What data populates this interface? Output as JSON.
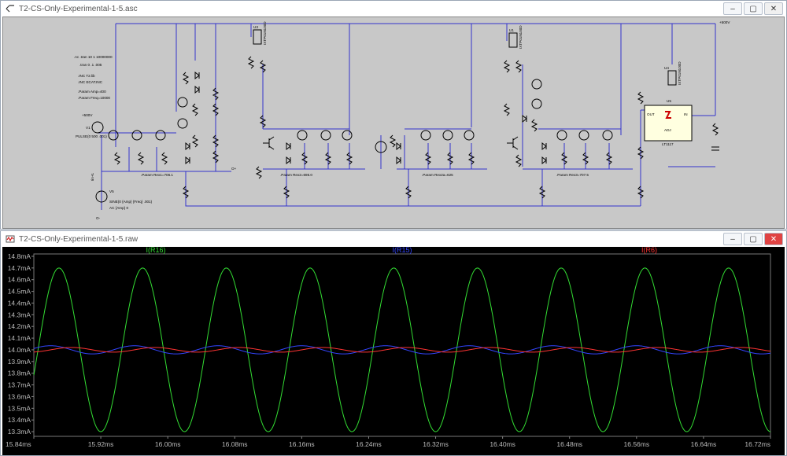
{
  "schematic_window": {
    "title": "T2-CS-Only-Experimental-1-5.asc",
    "colors": {
      "background": "#c8c8c8",
      "wire": "#3333cc",
      "component": "#000000"
    },
    "directives": [
      ".nc .tran 10 1 10000000",
      ".tran 0 .1 .005",
      ".INC T2.lib",
      ".INC ECAT.INC",
      ".Param Amp=400",
      ".Param Freq=10000"
    ],
    "supply_label": "+500V",
    "source_v1": "V1",
    "source_v1_value": "PULSE(0 500 .001)",
    "source_v5": "V5",
    "source_v5_value": "SINE(0 {Amp} {Freq} .001)",
    "source_v5_ac": "AC {Amp} 0",
    "probe_iin": "Iin+1",
    "params": [
      ".Param Rex1=706.1",
      ".Param Rex2=695.0",
      ".Param Rex2a=625",
      ".Param Rex3=707.5"
    ],
    "regulator": {
      "name": "U5",
      "part": "LT1117",
      "out": "OUT",
      "in": "IN",
      "adj": "ADJ"
    },
    "label_vo": "O+",
    "label_minus": "O-",
    "mosfets": [
      "U3",
      "U1",
      "U4"
    ],
    "mosfet_part": "IXTP01N100D"
  },
  "waveform_window": {
    "title": "T2-CS-Only-Experimental-1-5.raw",
    "x_ticks": [
      "15.84ms",
      "15.92ms",
      "16.00ms",
      "16.08ms",
      "16.16ms",
      "16.24ms",
      "16.32ms",
      "16.40ms",
      "16.48ms",
      "16.56ms",
      "16.64ms",
      "16.72ms"
    ],
    "y_ticks": [
      "14.8mA",
      "14.7mA",
      "14.6mA",
      "14.5mA",
      "14.4mA",
      "14.3mA",
      "14.2mA",
      "14.1mA",
      "14.0mA",
      "13.9mA",
      "13.8mA",
      "13.7mA",
      "13.6mA",
      "13.5mA",
      "13.4mA",
      "13.3mA"
    ],
    "traces": [
      {
        "name": "I(R16)",
        "color": "#33dd33"
      },
      {
        "name": "I(R15)",
        "color": "#3344ff"
      },
      {
        "name": "I(R6)",
        "color": "#ff3333"
      }
    ]
  },
  "window_buttons": {
    "minimize": "–",
    "maximize": "▢",
    "close": "✕"
  },
  "chart_data": {
    "type": "line",
    "xlabel": "",
    "ylabel": "",
    "x_unit": "ms",
    "y_unit": "mA",
    "xlim": [
      15.84,
      16.72
    ],
    "ylim": [
      13.26,
      14.82
    ],
    "grid": false,
    "legend": "top",
    "series": [
      {
        "name": "I(R16)",
        "color": "#33dd33",
        "kind": "sine",
        "offset": 14.0,
        "amplitude": 0.7,
        "period_ms": 0.1,
        "peak_ms": 15.87
      },
      {
        "name": "I(R15)",
        "color": "#3344ff",
        "kind": "sine",
        "offset": 14.0,
        "amplitude": 0.035,
        "period_ms": 0.1,
        "peak_ms": 15.86
      },
      {
        "name": "I(R6)",
        "color": "#ff3333",
        "kind": "sine",
        "offset": 14.0,
        "amplitude": 0.02,
        "period_ms": 0.1,
        "peak_ms": 15.885
      }
    ]
  }
}
